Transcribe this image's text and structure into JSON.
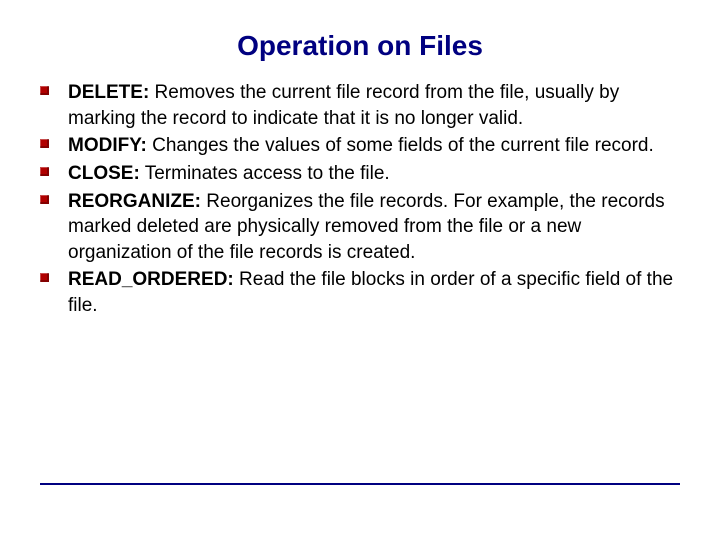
{
  "title": "Operation on Files",
  "items": [
    {
      "term": "DELETE:",
      "desc": " Removes the current file record from the file, usually by marking the record to indicate that it is no longer valid."
    },
    {
      "term": "MODIFY:",
      "desc": " Changes the values of some fields of the current file record."
    },
    {
      "term": "CLOSE:",
      "desc": " Terminates access to the file."
    },
    {
      "term": "REORGANIZE:",
      "desc": " Reorganizes the file records. For example, the records marked deleted are physically removed from the file or a new organization of the file records is created."
    },
    {
      "term": "READ_ORDERED:",
      "desc": " Read the file blocks in order of a specific field of the file."
    }
  ]
}
